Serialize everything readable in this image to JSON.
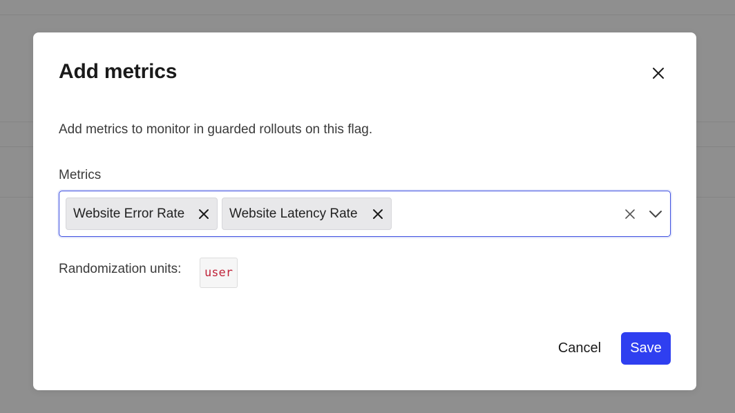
{
  "modal": {
    "title": "Add metrics",
    "description": "Add metrics to monitor in guarded rollouts on this flag.",
    "close_icon": "close-icon"
  },
  "metrics_field": {
    "label": "Metrics",
    "selected": [
      {
        "label": "Website Error Rate"
      },
      {
        "label": "Website Latency Rate"
      }
    ],
    "clear_icon": "clear-icon",
    "dropdown_icon": "chevron-down-icon",
    "focus_color": "#3d4fe0"
  },
  "randomization": {
    "label": "Randomization units:",
    "value": "user"
  },
  "footer": {
    "cancel_label": "Cancel",
    "save_label": "Save",
    "save_color": "#2f3ff0"
  }
}
